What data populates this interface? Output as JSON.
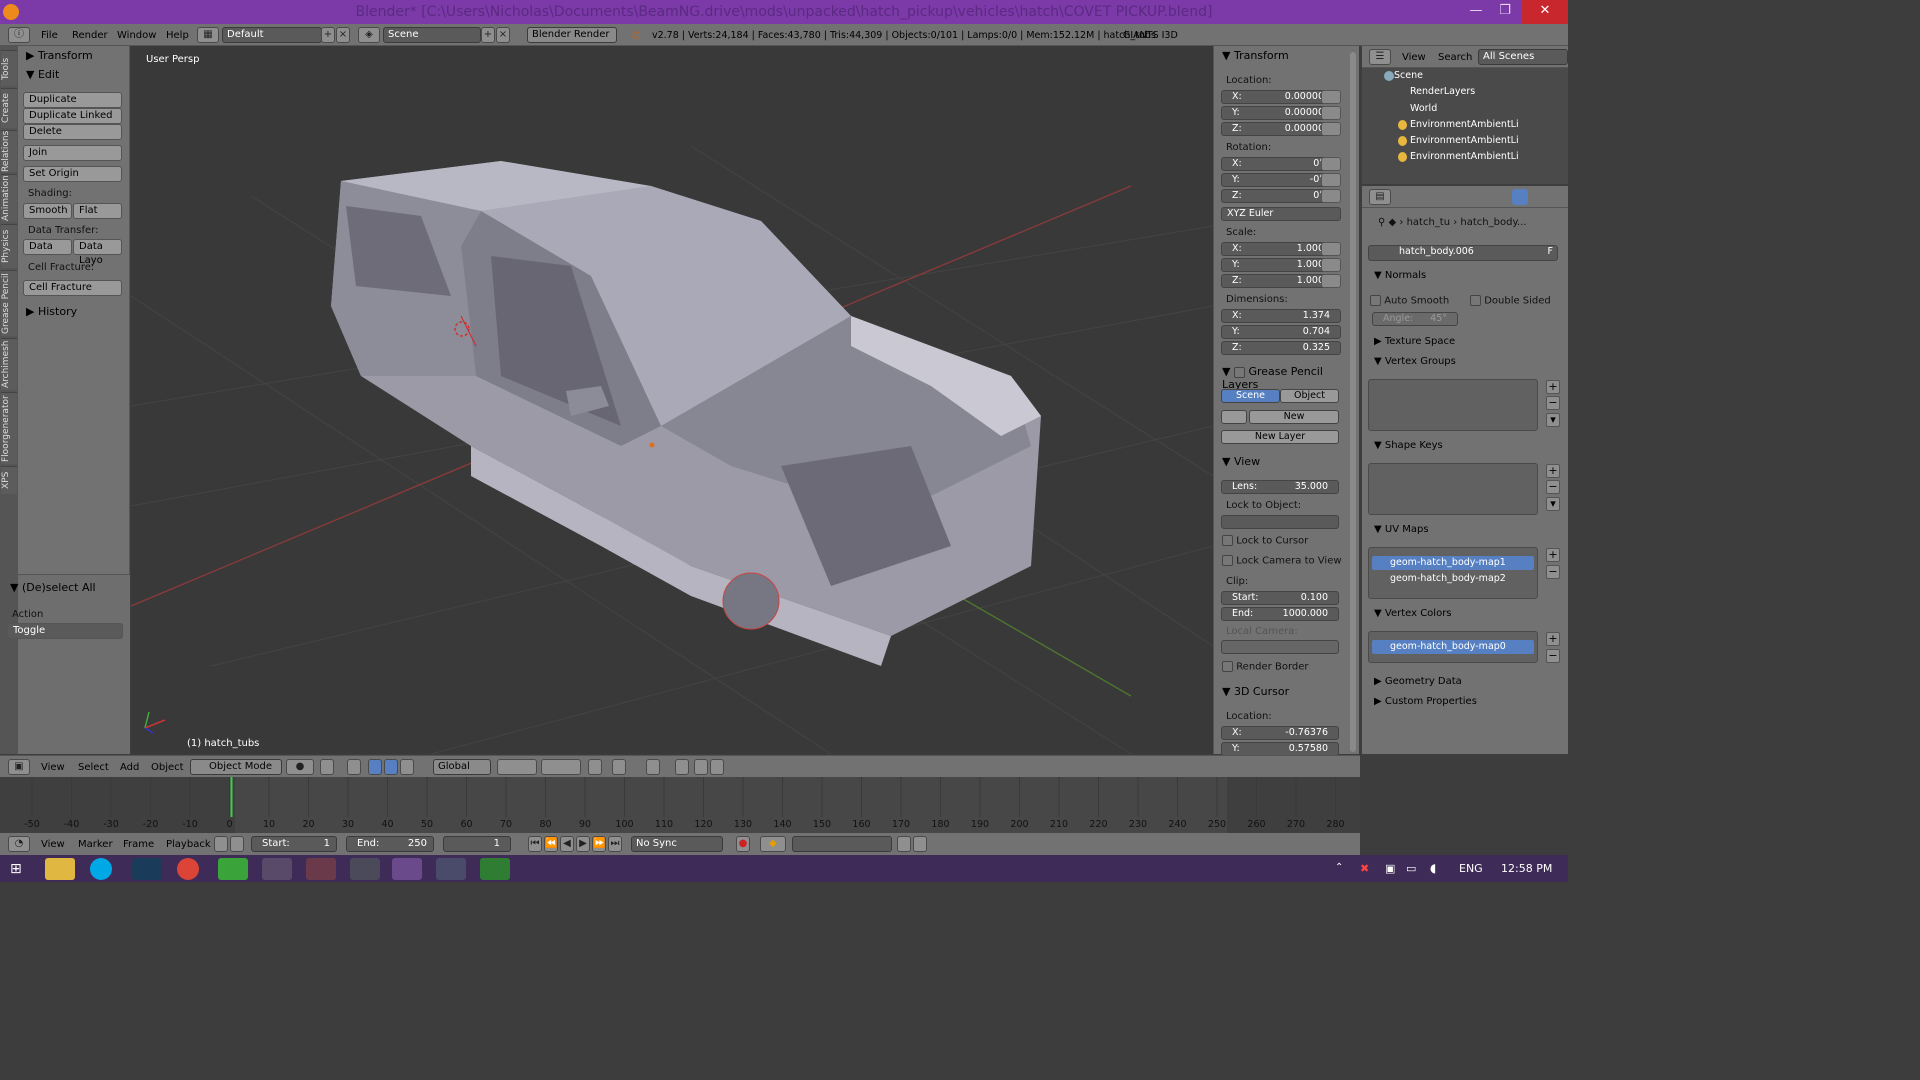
{
  "window": {
    "title": "Blender* [C:\\Users\\Nicholas\\Documents\\BeamNG.drive\\mods\\unpacked\\hatch_pickup\\vehicles\\hatch\\COVET PICKUP.blend]",
    "min": "—",
    "max": "❐",
    "close": "✕"
  },
  "menubar": {
    "items": [
      "File",
      "Render",
      "Window",
      "Help"
    ],
    "layout": "Default",
    "scene": "Scene",
    "engine": "Blender Render",
    "stats": "v2.78 | Verts:24,184 | Faces:43,780 | Tris:44,309 | Objects:0/101 | Lamps:0/0 | Mem:152.12M | hatch_tubs",
    "addon": "GIANTS I3D"
  },
  "tabs": [
    "Tools",
    "Create",
    "Relations",
    "Animation",
    "Physics",
    "Grease Pencil",
    "Archimesh",
    "Floorgenerator",
    "XPS"
  ],
  "toolshelf": {
    "transform": "Transform",
    "edit": "Edit",
    "duplicate": "Duplicate",
    "duplicate_linked": "Duplicate Linked",
    "delete": "Delete",
    "join": "Join",
    "set_origin": "Set Origin",
    "shading": "Shading:",
    "smooth": "Smooth",
    "flat": "Flat",
    "data_transfer": "Data Transfer:",
    "data": "Data",
    "data_layout": "Data Layo",
    "cell_fracture_lbl": "Cell Fracture:",
    "cell_fracture": "Cell Fracture",
    "history": "History",
    "deselect_all": "(De)select All",
    "action": "Action",
    "toggle": "Toggle"
  },
  "viewport": {
    "persp": "User Persp",
    "object_name": "(1) hatch_tubs"
  },
  "npanel": {
    "transform": "Transform",
    "location": "Location:",
    "loc": [
      "0.00000",
      "0.00000",
      "0.00000"
    ],
    "rotation": "Rotation:",
    "rot": [
      "0°",
      "-0°",
      "0°"
    ],
    "euler": "XYZ Euler",
    "scale": "Scale:",
    "scl": [
      "1.000",
      "1.000",
      "1.000"
    ],
    "dimensions": "Dimensions:",
    "dim": [
      "1.374",
      "0.704",
      "0.325"
    ],
    "axes": [
      "X:",
      "Y:",
      "Z:"
    ],
    "grease": "Grease Pencil Layers",
    "scene_tab": "Scene",
    "object_tab": "Object",
    "new": "New",
    "new_layer": "New Layer",
    "view": "View",
    "lens_lbl": "Lens:",
    "lens": "35.000",
    "lock_obj": "Lock to Object:",
    "lock_cursor": "Lock to Cursor",
    "lock_camera": "Lock Camera to View",
    "clip": "Clip:",
    "start_lbl": "Start:",
    "start": "0.100",
    "end_lbl": "End:",
    "end": "1000.000",
    "local_camera": "Local Camera:",
    "render_border": "Render Border",
    "cursor": "3D Cursor",
    "cursor_loc": "Location:",
    "cx": "-0.76376",
    "cy": "0.57580"
  },
  "outliner": {
    "view": "View",
    "search": "Search",
    "all_scenes": "All Scenes",
    "rows": [
      "Scene",
      "RenderLayers",
      "World",
      "EnvironmentAmbientLi",
      "EnvironmentAmbientLi",
      "EnvironmentAmbientLi"
    ]
  },
  "properties": {
    "crumb1": "hatch_tu",
    "crumb2": "hatch_body...",
    "mesh_name": "hatch_body.006",
    "fake": "F",
    "normals": "Normals",
    "auto_smooth": "Auto Smooth",
    "double_sided": "Double Sided",
    "angle": "Angle:",
    "angle_val": "45°",
    "texture_space": "Texture Space",
    "vertex_groups": "Vertex Groups",
    "shape_keys": "Shape Keys",
    "uv_maps": "UV Maps",
    "uv": [
      "geom-hatch_body-map1",
      "geom-hatch_body-map2"
    ],
    "vertex_colors": "Vertex Colors",
    "vc": [
      "geom-hatch_body-map0"
    ],
    "geometry_data": "Geometry Data",
    "custom_props": "Custom Properties"
  },
  "viewheader": {
    "view": "View",
    "select": "Select",
    "add": "Add",
    "object": "Object",
    "mode": "Object Mode",
    "orientation": "Global"
  },
  "timeline": {
    "ticks": [
      "-50",
      "-40",
      "-30",
      "-20",
      "-10",
      "0",
      "10",
      "20",
      "30",
      "40",
      "50",
      "60",
      "70",
      "80",
      "90",
      "100",
      "110",
      "120",
      "130",
      "140",
      "150",
      "160",
      "170",
      "180",
      "190",
      "200",
      "210",
      "220",
      "230",
      "240",
      "250",
      "260",
      "270",
      "280"
    ],
    "current": 0
  },
  "tlheader": {
    "view": "View",
    "marker": "Marker",
    "frame": "Frame",
    "playback": "Playback",
    "start": "Start:",
    "start_val": "1",
    "end": "End:",
    "end_val": "250",
    "cur": "1",
    "sync": "No Sync"
  },
  "taskbar": {
    "lang": "ENG",
    "time": "12:58 PM"
  },
  "colors": {
    "title_bg": "#7b3aa7",
    "panel": "#727272",
    "viewport": "#393939",
    "select": "#5680c2",
    "taskbar": "#3e2b57"
  }
}
